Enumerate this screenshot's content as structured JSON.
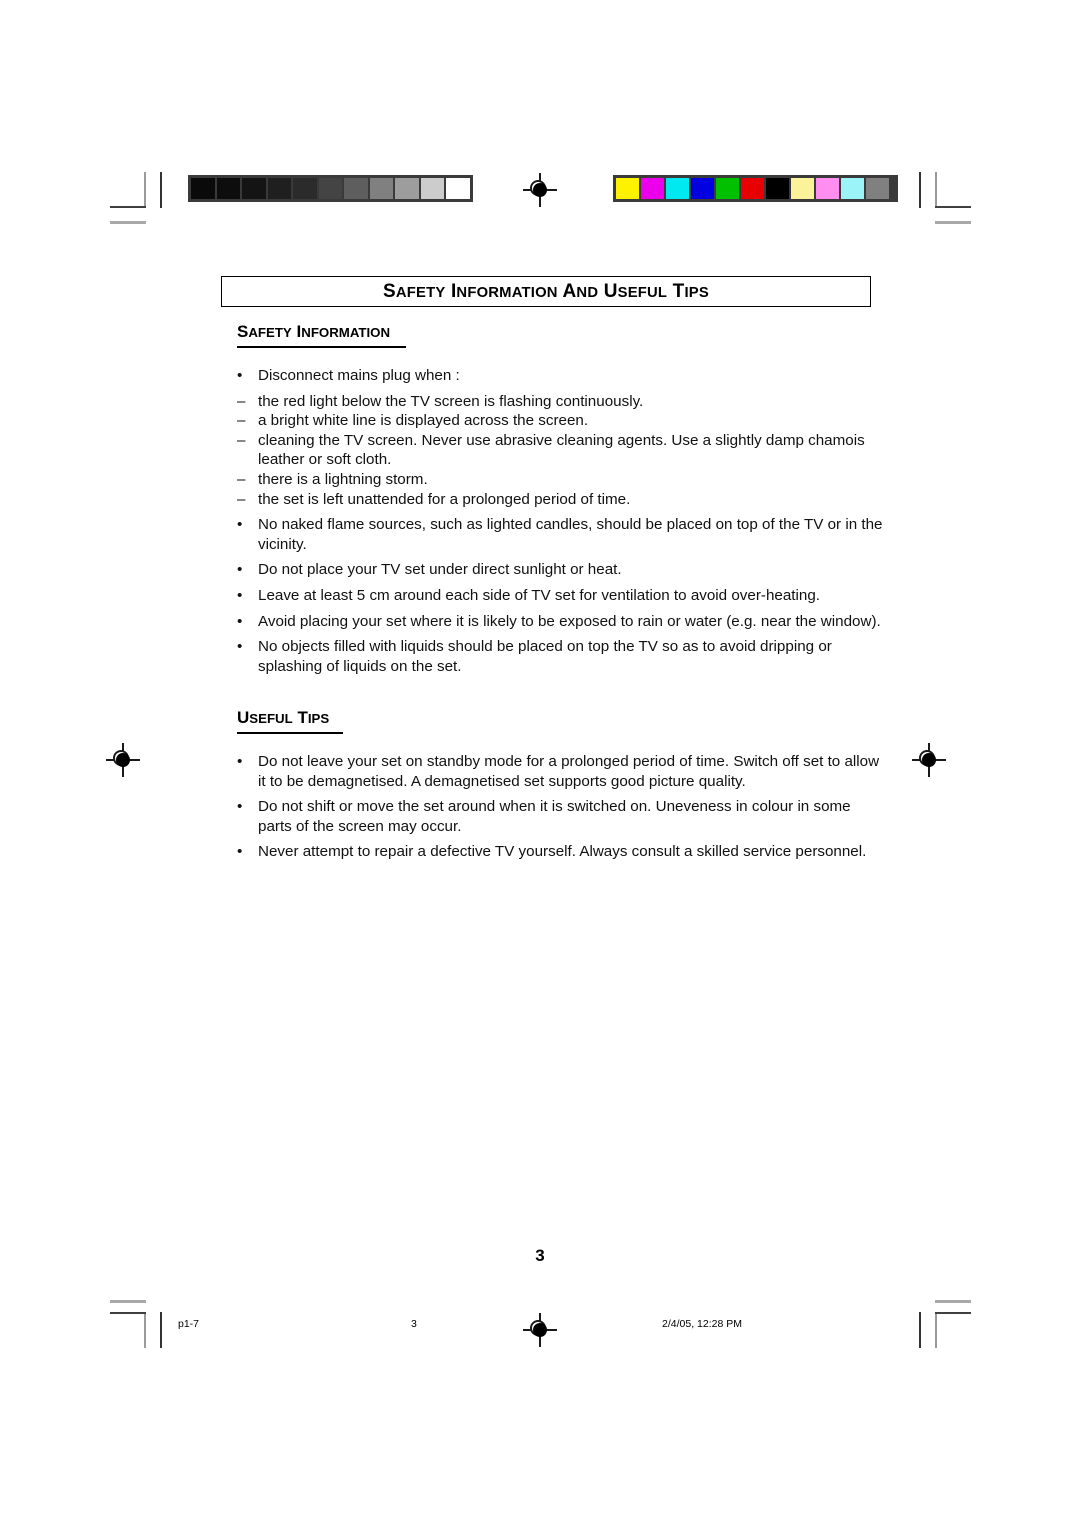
{
  "document": {
    "title_box": "SAFETY INFORMATION AND USEFUL TIPS",
    "page_number": "3"
  },
  "sections": [
    {
      "heading": "SAFETY INFORMATION",
      "items": [
        {
          "marker": "•",
          "text": "Disconnect mains plug when :",
          "type": "bullet"
        },
        {
          "marker": "–",
          "text": "the red light below the TV screen is flashing continuously.",
          "type": "dash"
        },
        {
          "marker": "–",
          "text": "a bright white line is displayed across the screen.",
          "type": "dash"
        },
        {
          "marker": "–",
          "text": "cleaning the TV screen. Never use abrasive cleaning agents. Use a slightly damp chamois leather or soft cloth.",
          "type": "dash"
        },
        {
          "marker": "–",
          "text": "there is a lightning storm.",
          "type": "dash"
        },
        {
          "marker": "–",
          "text": "the set is left unattended for a prolonged period of time.",
          "type": "dash"
        },
        {
          "marker": "•",
          "text": "No naked flame sources, such as lighted candles, should be placed on top of the TV or in the vicinity.",
          "type": "bullet-gap"
        },
        {
          "marker": "•",
          "text": "Do not place your TV set under direct sunlight or heat.",
          "type": "bullet"
        },
        {
          "marker": "•",
          "text": "Leave at least 5 cm around each side of TV set for ventilation to avoid over-heating.",
          "type": "bullet"
        },
        {
          "marker": "•",
          "text": "Avoid placing your set where it is likely to be exposed to rain or water (e.g. near the window).",
          "type": "bullet"
        },
        {
          "marker": "•",
          "text": "No objects filled with liquids should be placed on top the TV so as to avoid dripping or splashing of liquids on the set.",
          "type": "bullet"
        }
      ]
    },
    {
      "heading": "USEFUL TIPS",
      "items": [
        {
          "marker": "•",
          "text": "Do not leave your set on standby mode for a prolonged period of time. Switch off set to allow it to be demagnetised. A demagnetised set supports good picture quality.",
          "type": "bullet"
        },
        {
          "marker": "•",
          "text": "Do not shift or move the set around when it is switched on. Uneveness in colour in some parts of the screen may occur.",
          "type": "bullet"
        },
        {
          "marker": "•",
          "text": "Never attempt to repair a defective TV yourself. Always consult a skilled service personnel.",
          "type": "bullet"
        }
      ]
    }
  ],
  "footer": {
    "file_label": "p1-7",
    "page_label": "3",
    "timestamp": "2/4/05, 12:28 PM"
  },
  "print_marks": {
    "grayscale_patches": [
      "#0a0a0a",
      "#0d0d0d",
      "#141414",
      "#1f1f1f",
      "#2b2b2b",
      "#444444",
      "#5e5e5e",
      "#808080",
      "#9d9d9d",
      "#cccccc",
      "#ffffff"
    ],
    "color_patches": [
      "#fff200",
      "#ec00ec",
      "#00e8f0",
      "#0000e0",
      "#00c000",
      "#e80000",
      "#000000",
      "#fbf39a",
      "#ff8ef0",
      "#9bf4f8",
      "#808080"
    ]
  }
}
